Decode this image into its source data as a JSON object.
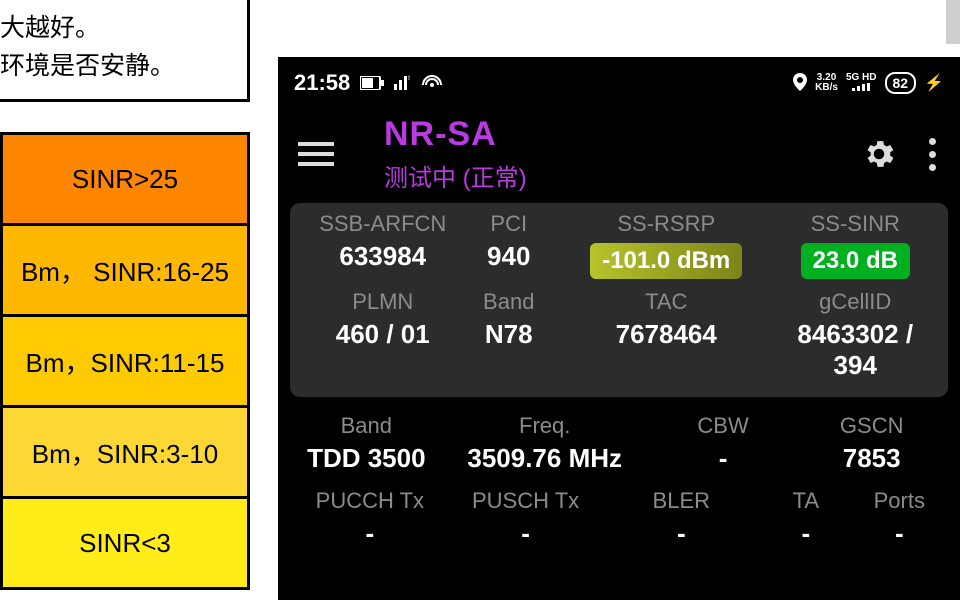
{
  "left": {
    "line1": "大越好。",
    "line2": "环境是否安静。",
    "grades": [
      "SINR>25",
      "Bm， SINR:16-25",
      "Bm，SINR:11-15",
      "Bm，SINR:3-10",
      "SINR<3"
    ]
  },
  "statusbar": {
    "time": "21:58",
    "kb_rate": "3.20",
    "kb_unit": "KB/s",
    "net": "5G HD",
    "battery": "82"
  },
  "app": {
    "title": "NR-SA",
    "subtitle": "测试中 (正常)"
  },
  "primary": {
    "labels": {
      "ssb_arfcn": "SSB-ARFCN",
      "pci": "PCI",
      "ss_rsrp": "SS-RSRP",
      "ss_sinr": "SS-SINR",
      "plmn": "PLMN",
      "band": "Band",
      "tac": "TAC",
      "gcellid": "gCellID"
    },
    "values": {
      "ssb_arfcn": "633984",
      "pci": "940",
      "ss_rsrp": "-101.0 dBm",
      "ss_sinr": "23.0 dB",
      "plmn": "460 / 01",
      "band": "N78",
      "tac": "7678464",
      "gcellid": "8463302 / 394"
    }
  },
  "secondary": {
    "labels": {
      "band": "Band",
      "freq": "Freq.",
      "cbw": "CBW",
      "gscn": "GSCN",
      "pucch": "PUCCH Tx",
      "pusch": "PUSCH Tx",
      "bler": "BLER",
      "ta": "TA",
      "ports": "Ports"
    },
    "values": {
      "band": "TDD 3500",
      "freq": "3509.76 MHz",
      "cbw": "-",
      "gscn": "7853",
      "pucch": "-",
      "pusch": "-",
      "bler": "-",
      "ta": "-",
      "ports": "-"
    }
  }
}
